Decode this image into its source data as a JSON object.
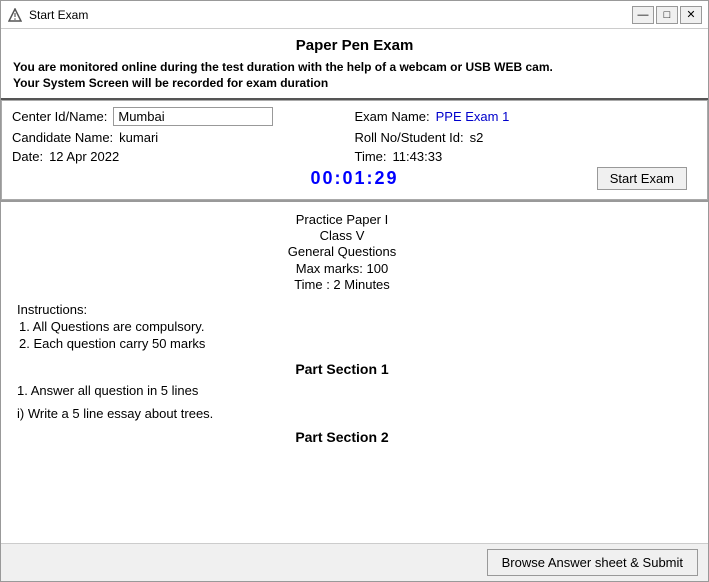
{
  "window": {
    "title": "Start Exam",
    "minimize_label": "—",
    "maximize_label": "□",
    "close_label": "✕"
  },
  "header": {
    "title": "Paper Pen Exam",
    "notice_line1": "You are monitored online during the test duration with the help of a webcam or USB WEB cam.",
    "notice_line2": "Your System Screen will be recorded for exam duration"
  },
  "info": {
    "center_id_label": "Center Id/Name:",
    "center_id_value": "Mumbai",
    "exam_name_label": "Exam Name:",
    "exam_name_value": "PPE Exam 1",
    "candidate_name_label": "Candidate Name:",
    "candidate_name_value": "kumari",
    "roll_no_label": "Roll No/Student Id:",
    "roll_no_value": "s2",
    "date_label": "Date:",
    "date_value": "12 Apr 2022",
    "time_label": "Time:",
    "time_value": "11:43:33"
  },
  "timer": {
    "value": "00:01:29"
  },
  "buttons": {
    "start_exam": "Start Exam",
    "browse_submit": "Browse Answer sheet & Submit"
  },
  "paper": {
    "title": "Practice Paper I",
    "class": "Class V",
    "subject": "General Questions",
    "max_marks": "Max marks: 100",
    "time": "Time : 2 Minutes",
    "instructions_title": "Instructions:",
    "instructions": [
      "1. All Questions are compulsory.",
      "2. Each question carry 50 marks"
    ],
    "part1_title": "Part Section 1",
    "part1_instruction": "1. Answer all question in 5 lines",
    "part1_question": "i) Write a 5 line essay about trees.",
    "part2_title": "Part Section 2"
  }
}
